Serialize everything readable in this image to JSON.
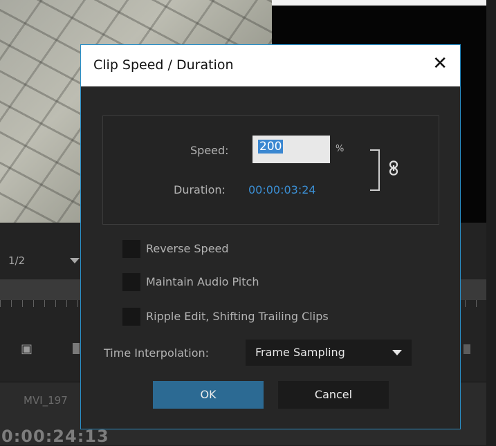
{
  "background": {
    "zoom_level": "1/2",
    "clip_name": "MVI_197",
    "timecode": "0:00:24:13"
  },
  "dialog": {
    "title": "Clip Speed / Duration",
    "close_glyph": "✕",
    "speed_label": "Speed:",
    "speed_value": "200",
    "speed_unit": "%",
    "duration_label": "Duration:",
    "duration_value": "00:00:03:24",
    "link_icon": "chain-link-icon",
    "checkboxes": [
      {
        "label": "Reverse Speed",
        "checked": false
      },
      {
        "label": "Maintain Audio Pitch",
        "checked": false
      },
      {
        "label": "Ripple Edit, Shifting Trailing Clips",
        "checked": false
      }
    ],
    "interpolation_label": "Time Interpolation:",
    "interpolation_value": "Frame Sampling",
    "ok_label": "OK",
    "cancel_label": "Cancel"
  },
  "colors": {
    "accent_border": "#2a8fc7",
    "ok_button": "#2c6a93",
    "duration_text": "#3b8fd4",
    "selection_highlight": "#3a87d1"
  }
}
